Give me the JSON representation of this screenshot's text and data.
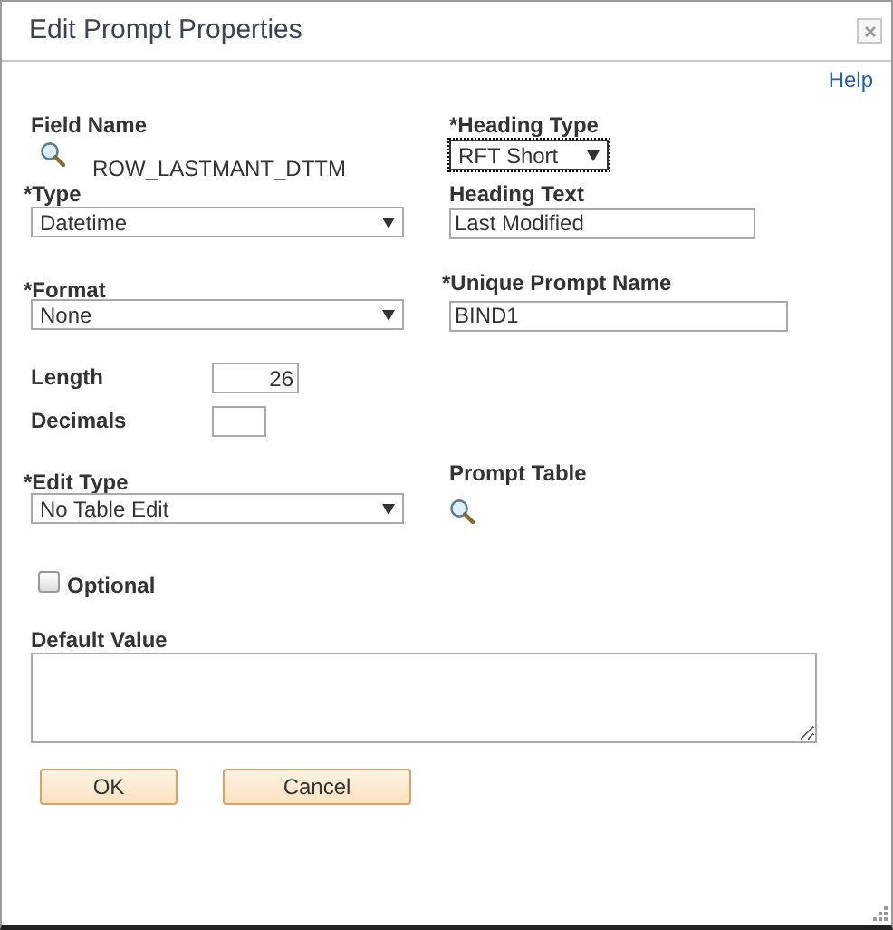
{
  "window": {
    "title": "Edit Prompt Properties"
  },
  "help_link": "Help",
  "field_name": {
    "label": "Field Name",
    "value": "ROW_LASTMANT_DTTM"
  },
  "heading_type": {
    "label": "*Heading Type",
    "value": "RFT Short",
    "focused": true
  },
  "type": {
    "label": "*Type",
    "value": "Datetime"
  },
  "heading_text": {
    "label": "Heading Text",
    "value": "Last Modified"
  },
  "format": {
    "label": "*Format",
    "value": "None"
  },
  "unique_prompt_name": {
    "label": "*Unique Prompt Name",
    "value": "BIND1"
  },
  "length": {
    "label": "Length",
    "value": "26"
  },
  "decimals": {
    "label": "Decimals"
  },
  "edit_type": {
    "label": "*Edit Type",
    "value": "No Table Edit"
  },
  "prompt_table": {
    "label": "Prompt Table"
  },
  "optional": {
    "label": "Optional",
    "checked": false
  },
  "default_value": {
    "label": "Default Value"
  },
  "buttons": [
    "OK",
    "Cancel"
  ]
}
